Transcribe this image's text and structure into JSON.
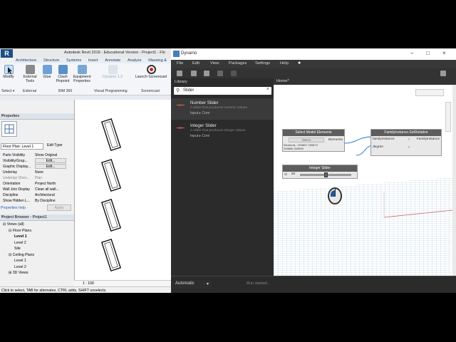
{
  "revit": {
    "title": "Autodesk Revit 2016 - Educational Version -  Project1 - Flo",
    "logo": "R",
    "tabs": [
      "Architecture",
      "Structure",
      "Systems",
      "Insert",
      "Annotate",
      "Analyze",
      "Massing &"
    ],
    "ribbon": {
      "buttons": [
        {
          "label": "Modify",
          "icon": "cursor-icon"
        },
        {
          "label": "External Tools",
          "icon": "toolbox-icon"
        },
        {
          "label": "Glue",
          "icon": "glue-icon"
        },
        {
          "label": "Clash Pinpoint",
          "icon": "clash-icon"
        },
        {
          "label": "Equipment Properties",
          "icon": "equipment-icon"
        },
        {
          "label": "Dynamo 1.2",
          "icon": "dynamo-icon"
        },
        {
          "label": "Launch Screencast",
          "icon": "record-icon"
        }
      ],
      "panels": [
        "Select ▾",
        "External",
        "BIM 360",
        "Visual Programming",
        "Screencast"
      ]
    },
    "properties": {
      "title": "Properties",
      "dropdown": "Floor Plan: Level 1",
      "edit_type": "Edit Type",
      "rows": [
        {
          "k": "Parts Visibility",
          "v": "Show Original"
        },
        {
          "k": "Visibility/Grap...",
          "v": "Edit..."
        },
        {
          "k": "Graphic Display...",
          "v": "Edit..."
        },
        {
          "k": "Underlay",
          "v": "None"
        },
        {
          "k": "Underlay Orien...",
          "v": "Plan"
        },
        {
          "k": "Orientation",
          "v": "Project North"
        },
        {
          "k": "Wall Join Display",
          "v": "Clean all wall..."
        },
        {
          "k": "Discipline",
          "v": "Architectural"
        },
        {
          "k": "Show Hidden L...",
          "v": "By Discipline"
        }
      ],
      "help": "Properties help",
      "apply": "Apply"
    },
    "browser": {
      "title": "Project Browser - Project1",
      "tree": [
        {
          "label": "Views (all)",
          "indent": 0,
          "prefix": "⊟"
        },
        {
          "label": "Floor Plans",
          "indent": 1,
          "prefix": "⊟"
        },
        {
          "label": "Level 1",
          "indent": 2,
          "prefix": ""
        },
        {
          "label": "Level 2",
          "indent": 2,
          "prefix": ""
        },
        {
          "label": "Site",
          "indent": 2,
          "prefix": ""
        },
        {
          "label": "Ceiling Plans",
          "indent": 1,
          "prefix": "⊟"
        },
        {
          "label": "Level 1",
          "indent": 2,
          "prefix": ""
        },
        {
          "label": "Level 2",
          "indent": 2,
          "prefix": ""
        },
        {
          "label": "3D Views",
          "indent": 1,
          "prefix": "⊞"
        }
      ]
    },
    "scale": "1 : 100",
    "status": "Click to select, TAB for alternates, CTRL adds, SHIFT unselects."
  },
  "dynamo": {
    "title": "Dynamo",
    "menu": [
      "File",
      "Edit",
      "View",
      "Packages",
      "Settings",
      "Help"
    ],
    "library_title": "Library",
    "search_query": "Slider",
    "results": [
      {
        "name": "Number Slider",
        "desc": "A slider that produces numeric values.",
        "cat": "Input  ▸  Core"
      },
      {
        "name": "Integer Slider",
        "desc": "A slider that produces integer values.",
        "cat": "Input  ▸  Core"
      }
    ],
    "tab": "Home*",
    "nodes": {
      "select_model_elements": {
        "title": "Select Model Elements",
        "button": "Select",
        "output": "Elements",
        "ids": "Elements : 209827 209873 209890 209990"
      },
      "integer_slider": {
        "title": "Integer Slider",
        "value": "60"
      },
      "set_rotation": {
        "title": "FamilyInstance.SetRotation",
        "in1": "familyInstance",
        "in2": "degree",
        "out": "FamilyInstance"
      }
    },
    "run_mode": "Automatic",
    "run_status": "Run started..."
  },
  "colors": {
    "dynamo_bg": "#2b2b2b",
    "node_header": "#5d5d5d",
    "wire": "#4a90d9",
    "revit_blue": "#1b4f86"
  }
}
